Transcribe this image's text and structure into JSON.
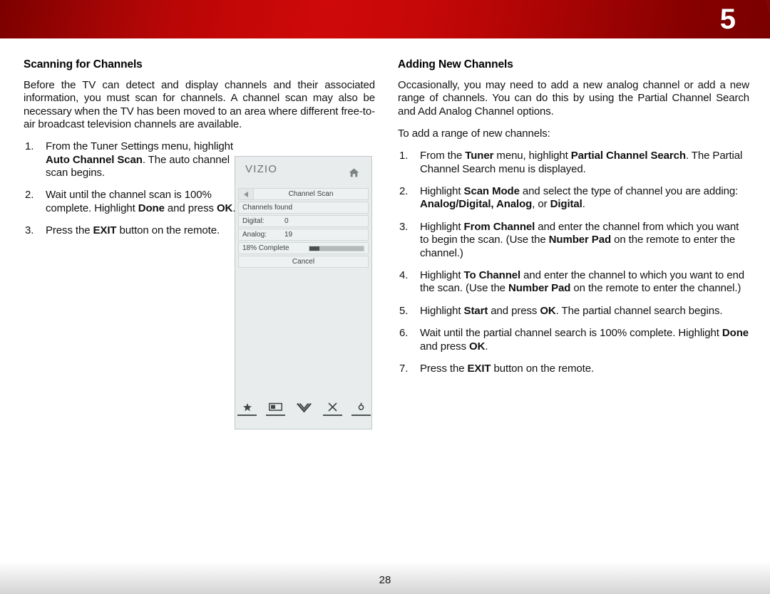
{
  "header": {
    "chapter_number": "5",
    "bar_color_dark": "#7c0000",
    "bar_color_bright": "#cf0909"
  },
  "footer": {
    "page_number": "28"
  },
  "left_column": {
    "title": "Scanning for Channels",
    "intro": "Before the TV can detect and display channels and their associated information, you must scan for channels. A channel scan may also be necessary when the TV has been moved to an area where different free-to-air broadcast television channels are available.",
    "steps": [
      {
        "number": "1.",
        "parts": [
          {
            "text": "From the Tuner Settings menu, highlight ",
            "bold": false
          },
          {
            "text": "Auto Channel Scan",
            "bold": true
          },
          {
            "text": ". The auto channel scan begins.",
            "bold": false
          }
        ]
      },
      {
        "number": "2.",
        "parts": [
          {
            "text": "Wait until the channel scan is 100% complete. Highlight ",
            "bold": false
          },
          {
            "text": "Done",
            "bold": true
          },
          {
            "text": " and press ",
            "bold": false
          },
          {
            "text": "OK",
            "bold": true
          },
          {
            "text": ".",
            "bold": false
          }
        ]
      },
      {
        "number": "3.",
        "parts": [
          {
            "text": "Press the ",
            "bold": false
          },
          {
            "text": "EXIT",
            "bold": true
          },
          {
            "text": " button on the remote.",
            "bold": false
          }
        ]
      }
    ]
  },
  "right_column": {
    "title": "Adding New Channels",
    "intro": "Occasionally, you may need to add a new analog channel or add a new range of channels. You can do this by using the Partial Channel Search and Add Analog Channel options.",
    "lead_in": "To add a range of new channels:",
    "steps": [
      {
        "number": "1.",
        "parts": [
          {
            "text": "From the ",
            "bold": false
          },
          {
            "text": "Tuner",
            "bold": true
          },
          {
            "text": " menu, highlight ",
            "bold": false
          },
          {
            "text": "Partial Channel Search",
            "bold": true
          },
          {
            "text": ". The Partial Channel Search menu is displayed.",
            "bold": false
          }
        ]
      },
      {
        "number": "2.",
        "parts": [
          {
            "text": "Highlight ",
            "bold": false
          },
          {
            "text": "Scan Mode",
            "bold": true
          },
          {
            "text": " and select the type of channel you are adding: ",
            "bold": false
          },
          {
            "text": "Analog/Digital, Analog",
            "bold": true
          },
          {
            "text": ", or ",
            "bold": false
          },
          {
            "text": "Digital",
            "bold": true
          },
          {
            "text": ".",
            "bold": false
          }
        ]
      },
      {
        "number": "3.",
        "parts": [
          {
            "text": "Highlight ",
            "bold": false
          },
          {
            "text": "From Channel",
            "bold": true
          },
          {
            "text": " and enter the channel from which you want to begin the scan. (Use the ",
            "bold": false
          },
          {
            "text": "Number Pad",
            "bold": true
          },
          {
            "text": " on the remote to enter the channel.)",
            "bold": false
          }
        ]
      },
      {
        "number": "4.",
        "parts": [
          {
            "text": "Highlight ",
            "bold": false
          },
          {
            "text": "To Channel",
            "bold": true
          },
          {
            "text": " and enter the channel to which you want to end the scan. (Use the ",
            "bold": false
          },
          {
            "text": "Number Pad",
            "bold": true
          },
          {
            "text": " on the remote to enter the channel.)",
            "bold": false
          }
        ]
      },
      {
        "number": "5.",
        "parts": [
          {
            "text": "Highlight ",
            "bold": false
          },
          {
            "text": "Start",
            "bold": true
          },
          {
            "text": " and press ",
            "bold": false
          },
          {
            "text": "OK",
            "bold": true
          },
          {
            "text": ". The partial channel search begins.",
            "bold": false
          }
        ]
      },
      {
        "number": "6.",
        "parts": [
          {
            "text": "Wait until the partial channel search is 100% complete. Highlight ",
            "bold": false
          },
          {
            "text": "Done",
            "bold": true
          },
          {
            "text": " and press ",
            "bold": false
          },
          {
            "text": "OK",
            "bold": true
          },
          {
            "text": ".",
            "bold": false
          }
        ]
      },
      {
        "number": "7.",
        "parts": [
          {
            "text": "Press the ",
            "bold": false
          },
          {
            "text": "EXIT",
            "bold": true
          },
          {
            "text": " button on the remote.",
            "bold": false
          }
        ]
      }
    ]
  },
  "tv_screen": {
    "brand": "VIZIO",
    "home_icon": "home-icon",
    "back_icon": "back-arrow-icon",
    "menu_title": "Channel Scan",
    "rows": [
      {
        "label": "Channels found",
        "value": ""
      },
      {
        "label": "Digital:",
        "value": "0"
      },
      {
        "label": "Analog:",
        "value": "19"
      }
    ],
    "progress_label": "18% Complete",
    "progress_percent": 18,
    "cancel_label": "Cancel",
    "bottom_icons": [
      "star-icon",
      "picture-mode-icon",
      "chevron-down-icon",
      "close-x-icon",
      "gear-icon"
    ]
  }
}
